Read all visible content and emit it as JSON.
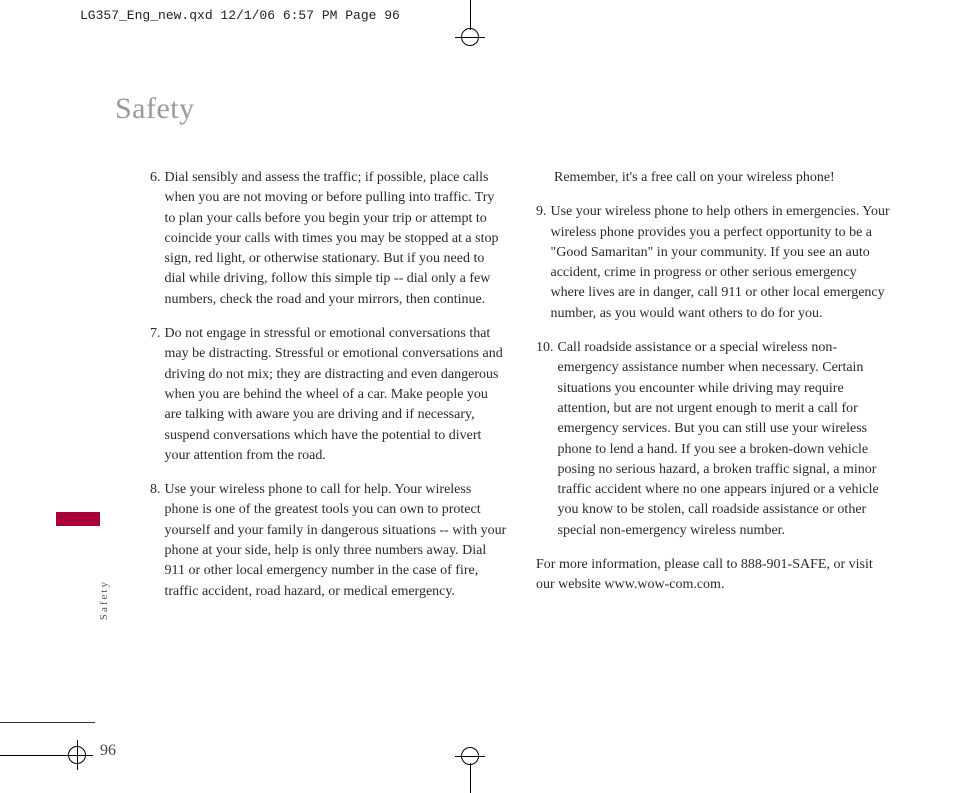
{
  "slug": "LG357_Eng_new.qxd  12/1/06  6:57 PM  Page 96",
  "title": "Safety",
  "side_label": "Safety",
  "page_number": "96",
  "items_col1": [
    {
      "n": "6.",
      "t": "Dial sensibly and assess the traffic; if possible, place calls when you are not moving or before pulling into traffic. Try to plan your calls before you begin your trip or attempt to coincide your calls with times you may be stopped at a stop sign, red light, or otherwise stationary. But if you need to dial while driving, follow this simple tip -- dial only a few numbers, check the road and your mirrors, then continue."
    },
    {
      "n": "7.",
      "t": "Do not engage in stressful or emotional conversations that may be distracting. Stressful or emotional conversations and driving do not mix; they are distracting and even dangerous when you are behind the wheel of a car. Make people you are talking with aware you are driving and if necessary, suspend conversations which have the potential to divert your attention from the road."
    },
    {
      "n": "8.",
      "t": "Use your wireless phone to call for help. Your wireless phone is one of the greatest tools you can own to protect yourself and your family in dangerous situations -- with your phone at your side, help is only three numbers away. Dial 911 or other local emergency number in the case of fire, traffic accident, road hazard, or medical emergency."
    }
  ],
  "remember": "Remember, it's a free call on your wireless phone!",
  "items_col2": [
    {
      "n": "9.",
      "t": "Use your wireless phone to help others in emergencies. Your wireless phone provides you a perfect opportunity to be a \"Good Samaritan\" in your community. If you see an auto accident, crime in progress or other serious emergency where lives are in danger, call 911 or other local emergency number, as you would want others to do for you."
    },
    {
      "n": "10.",
      "t": "Call roadside assistance or a special wireless non-emergency assistance number when necessary. Certain situations you encounter while driving may require attention, but are not urgent enough to merit a call for emergency services. But you can still  use your wireless phone to lend a hand. If you see a broken-down vehicle posing no serious hazard, a broken traffic signal, a minor traffic accident where no one appears injured or a vehicle you know to be stolen, call roadside assistance or other special non-emergency wireless number."
    }
  ],
  "closing": "For more information, please call to 888-901-SAFE, or visit our website www.wow-com.com."
}
